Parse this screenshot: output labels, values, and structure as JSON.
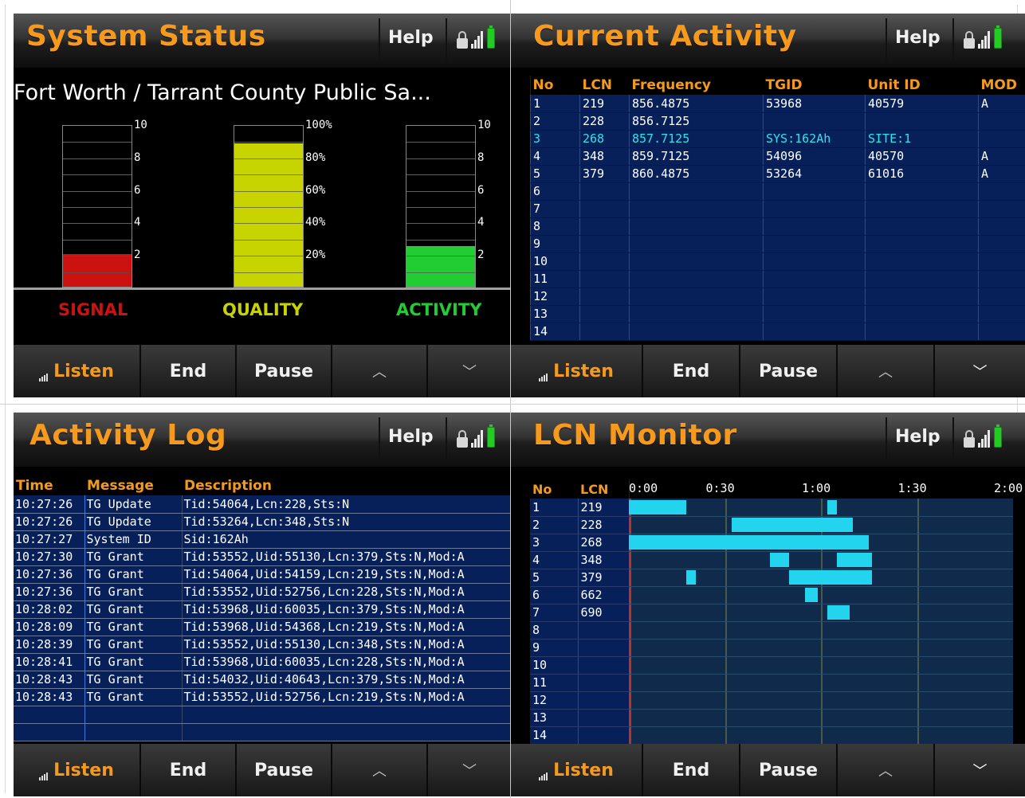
{
  "shared": {
    "help_label": "Help",
    "softkeys": {
      "listen": "Listen",
      "end": "End",
      "pause": "Pause",
      "up": "^",
      "down": "v"
    },
    "icons": {
      "lock": "lock-icon",
      "signal": "signal-bars-icon",
      "battery": "battery-icon"
    },
    "colors": {
      "accent": "#f59a1c",
      "signal": "#cc1111",
      "quality": "#c8d400",
      "activity": "#22cc33",
      "table_bg": "#07205a",
      "cyan": "#2ee6e6"
    }
  },
  "system_status": {
    "title": "System Status",
    "site_name": "Fort Worth / Tarrant County Public Sa...",
    "gauges": {
      "signal": {
        "label": "SIGNAL",
        "value": 2,
        "max": 10,
        "ticks": [
          "10",
          "8",
          "6",
          "4",
          "2"
        ]
      },
      "quality": {
        "label": "QUALITY",
        "value_percent": 88,
        "ticks": [
          "100%",
          "80%",
          "60%",
          "40%",
          "20%"
        ]
      },
      "activity": {
        "label": "ACTIVITY",
        "value": 2.5,
        "max": 10,
        "ticks": [
          "10",
          "8",
          "6",
          "4",
          "2"
        ]
      }
    }
  },
  "current_activity": {
    "title": "Current Activity",
    "columns": [
      "No",
      "LCN",
      "Frequency",
      "TGID",
      "Unit ID",
      "MOD"
    ],
    "rows": [
      [
        "1",
        "219",
        "856.4875",
        "53968",
        "40579",
        "A"
      ],
      [
        "2",
        "228",
        "856.7125",
        "",
        "",
        ""
      ],
      [
        "3",
        "268",
        "857.7125",
        "SYS:162Ah",
        "SITE:1",
        ""
      ],
      [
        "4",
        "348",
        "859.7125",
        "54096",
        "40570",
        "A"
      ],
      [
        "5",
        "379",
        "860.4875",
        "53264",
        "61016",
        "A"
      ],
      [
        "6",
        "",
        "",
        "",
        "",
        ""
      ],
      [
        "7",
        "",
        "",
        "",
        "",
        ""
      ],
      [
        "8",
        "",
        "",
        "",
        "",
        ""
      ],
      [
        "9",
        "",
        "",
        "",
        "",
        ""
      ],
      [
        "10",
        "",
        "",
        "",
        "",
        ""
      ],
      [
        "11",
        "",
        "",
        "",
        "",
        ""
      ],
      [
        "12",
        "",
        "",
        "",
        "",
        ""
      ],
      [
        "13",
        "",
        "",
        "",
        "",
        ""
      ],
      [
        "14",
        "",
        "",
        "",
        "",
        ""
      ]
    ]
  },
  "activity_log": {
    "title": "Activity Log",
    "columns": [
      "Time",
      "Message",
      "Description"
    ],
    "rows": [
      [
        "10:27:26",
        "TG Update",
        "Tid:54064,Lcn:228,Sts:N"
      ],
      [
        "10:27:26",
        "TG Update",
        "Tid:53264,Lcn:348,Sts:N"
      ],
      [
        "10:27:27",
        "System ID",
        "Sid:162Ah"
      ],
      [
        "10:27:30",
        "TG Grant",
        "Tid:53552,Uid:55130,Lcn:379,Sts:N,Mod:A"
      ],
      [
        "10:27:36",
        "TG Grant",
        "Tid:54064,Uid:54159,Lcn:219,Sts:N,Mod:A"
      ],
      [
        "10:27:36",
        "TG Grant",
        "Tid:53552,Uid:52756,Lcn:228,Sts:N,Mod:A"
      ],
      [
        "10:28:02",
        "TG Grant",
        "Tid:53968,Uid:60035,Lcn:379,Sts:N,Mod:A"
      ],
      [
        "10:28:09",
        "TG Grant",
        "Tid:53968,Uid:54368,Lcn:219,Sts:N,Mod:A"
      ],
      [
        "10:28:39",
        "TG Grant",
        "Tid:53552,Uid:55130,Lcn:348,Sts:N,Mod:A"
      ],
      [
        "10:28:41",
        "TG Grant",
        "Tid:53968,Uid:60035,Lcn:228,Sts:N,Mod:A"
      ],
      [
        "10:28:43",
        "TG Grant",
        "Tid:54032,Uid:40643,Lcn:379,Sts:N,Mod:A"
      ],
      [
        "10:28:43",
        "TG Grant",
        "Tid:53552,Uid:52756,Lcn:219,Sts:N,Mod:A"
      ],
      [
        "",
        "",
        ""
      ],
      [
        "",
        "",
        ""
      ]
    ]
  },
  "lcn_monitor": {
    "title": "LCN Monitor",
    "columns": [
      "No",
      "LCN"
    ],
    "time_ticks": [
      "0:00",
      "0:30",
      "1:00",
      "1:30",
      "2:00"
    ],
    "rows": [
      [
        "1",
        "219"
      ],
      [
        "2",
        "228"
      ],
      [
        "3",
        "268"
      ],
      [
        "4",
        "348"
      ],
      [
        "5",
        "379"
      ],
      [
        "6",
        "662"
      ],
      [
        "7",
        "690"
      ],
      [
        "8",
        ""
      ],
      [
        "9",
        ""
      ],
      [
        "10",
        ""
      ],
      [
        "11",
        ""
      ],
      [
        "12",
        ""
      ],
      [
        "13",
        ""
      ],
      [
        "14",
        ""
      ]
    ],
    "activity_seconds": [
      [
        [
          0,
          18
        ],
        [
          62,
          65
        ]
      ],
      [
        [
          32,
          70
        ]
      ],
      [
        [
          0,
          75
        ]
      ],
      [
        [
          44,
          50
        ],
        [
          65,
          76
        ]
      ],
      [
        [
          18,
          21
        ],
        [
          50,
          76
        ]
      ],
      [
        [
          55,
          59
        ]
      ],
      [
        [
          62,
          69
        ]
      ],
      [],
      [],
      [],
      [],
      [],
      [],
      []
    ]
  }
}
